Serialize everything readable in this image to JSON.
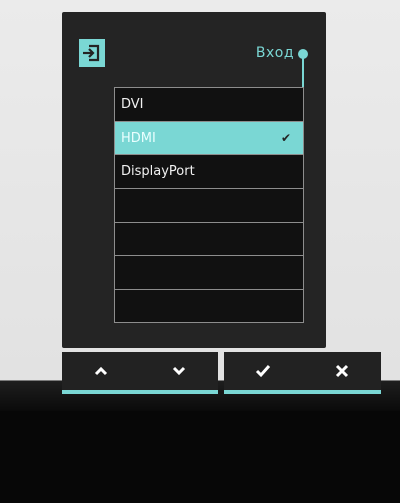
{
  "osd": {
    "title": "Вход",
    "inputs": [
      {
        "label": "DVI",
        "selected": false
      },
      {
        "label": "HDMI",
        "selected": true
      },
      {
        "label": "DisplayPort",
        "selected": false
      },
      {
        "label": "",
        "selected": false
      },
      {
        "label": "",
        "selected": false
      },
      {
        "label": "",
        "selected": false
      },
      {
        "label": "",
        "selected": false
      }
    ],
    "selected_check": "✔",
    "accent_color": "#7ad7d4",
    "icon": "input-source-icon"
  },
  "buttons": {
    "up": "▲",
    "down": "▼",
    "confirm": "✔",
    "exit": "✖"
  }
}
